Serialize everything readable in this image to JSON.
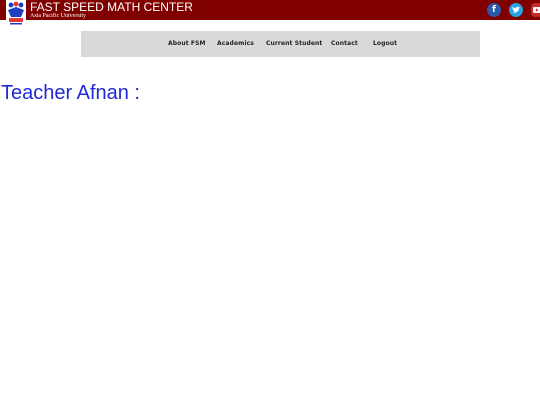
{
  "header": {
    "title": "FAST SPEED MATH CENTER",
    "subtitle": "Asia Pacific University",
    "logo_icon": "school-logo-icon",
    "social": [
      {
        "name": "facebook-icon",
        "glyph": "f"
      },
      {
        "name": "twitter-icon",
        "glyph": "t"
      },
      {
        "name": "youtube-icon",
        "glyph": "▶"
      }
    ]
  },
  "nav": {
    "items": [
      "About FSM",
      "Academics",
      "Current Student",
      "Contact",
      "Logout"
    ]
  },
  "main": {
    "heading": "Teacher Afnan :"
  },
  "colors": {
    "topbar": "#800000",
    "navbar": "#d9d9d9",
    "heading": "#1f2ad6"
  }
}
